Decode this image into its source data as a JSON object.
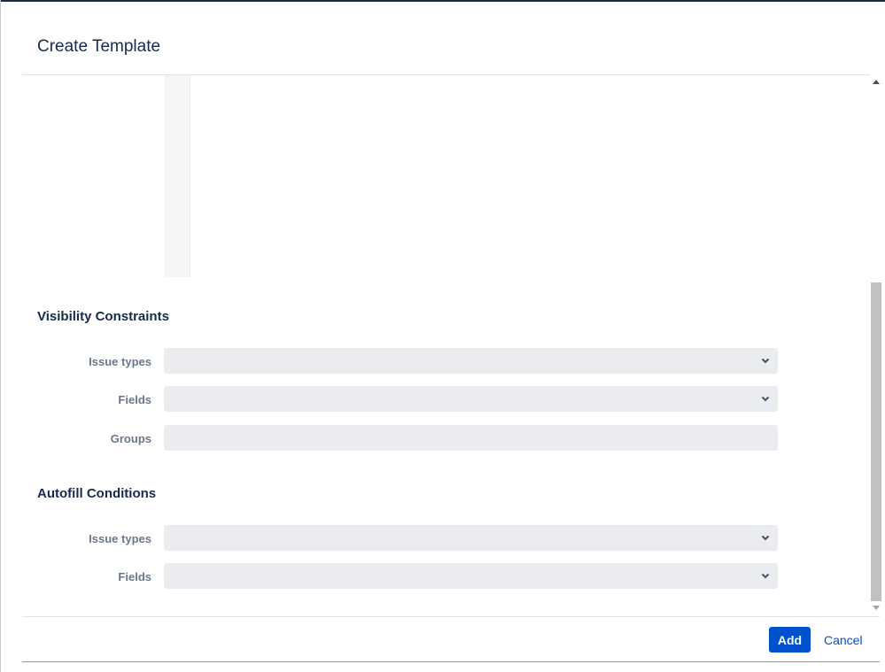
{
  "dialog": {
    "title": "Create Template",
    "close_label": "×"
  },
  "visibility_constraints": {
    "heading": "Visibility Constraints",
    "fields": [
      {
        "label": "Issue types",
        "type": "select",
        "value": ""
      },
      {
        "label": "Fields",
        "type": "select",
        "value": ""
      },
      {
        "label": "Groups",
        "type": "text",
        "value": ""
      }
    ]
  },
  "autofill_conditions": {
    "heading": "Autofill Conditions",
    "fields": [
      {
        "label": "Issue types",
        "type": "select",
        "value": ""
      },
      {
        "label": "Fields",
        "type": "select",
        "value": ""
      }
    ]
  },
  "footer": {
    "add_label": "Add",
    "cancel_label": "Cancel"
  },
  "colors": {
    "primary": "#0052cc",
    "field_background": "#ebecf0",
    "label_text": "#6b778c",
    "heading_text": "#172b4d"
  },
  "icons": {
    "close": "close-icon",
    "select": "chevron-down-icon"
  }
}
